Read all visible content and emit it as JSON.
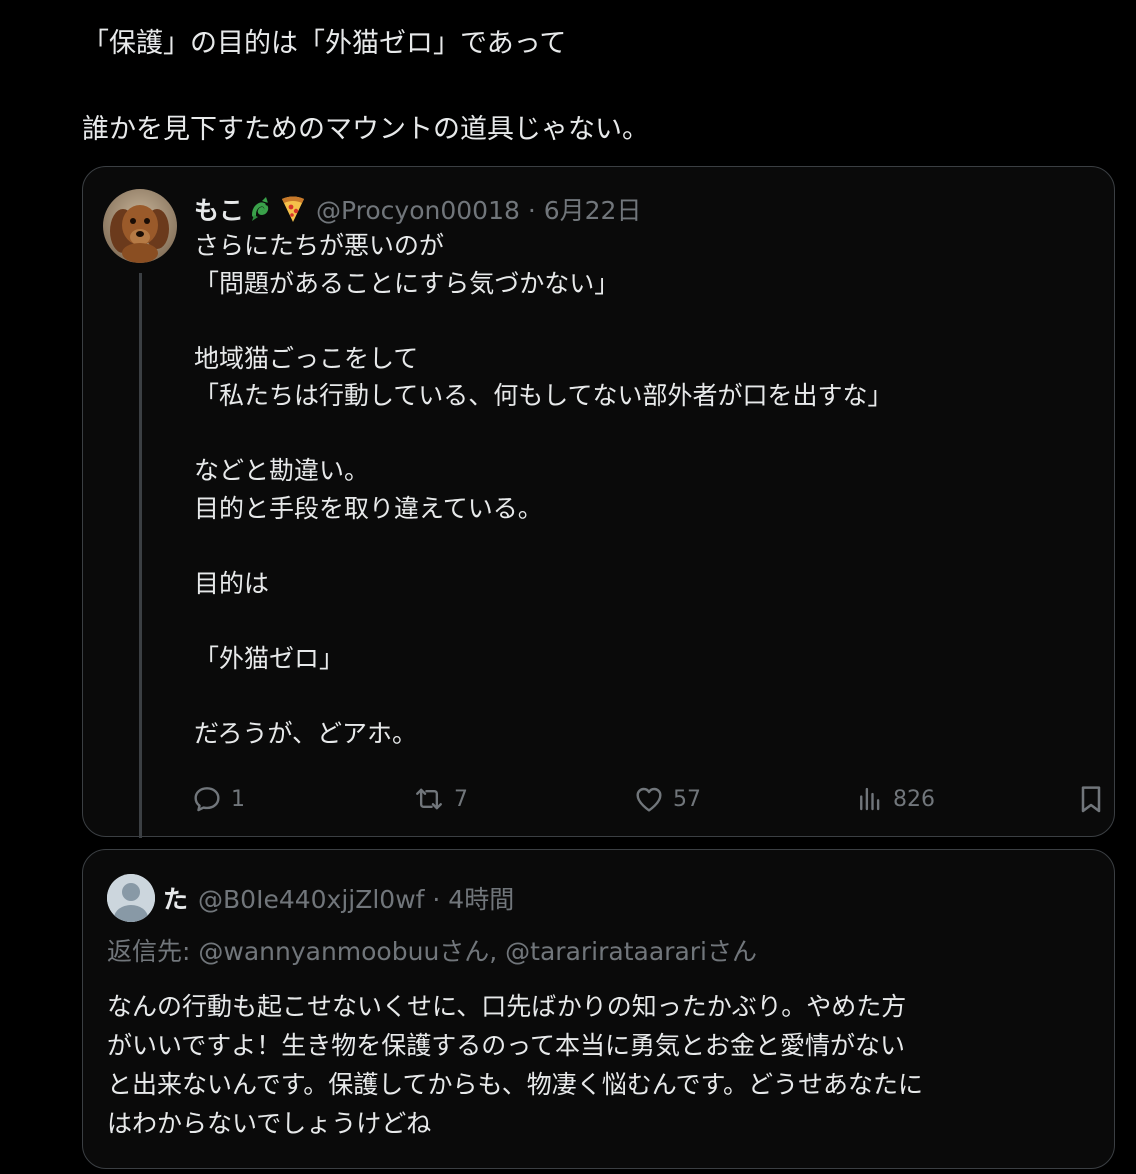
{
  "post": {
    "lines": [
      "「保護」の目的は「外猫ゼロ」であって",
      "",
      "誰かを見下すためのマウントの道具じゃない。"
    ]
  },
  "quoted": {
    "name": "もこ",
    "emoji_1": "🐉",
    "emoji_2": "🍕",
    "handle_time": "@Procyon00018 · 6月22日",
    "lines": [
      "さらにたちが悪いのが",
      "「問題があることにすら気づかない」",
      "",
      "地域猫ごっこをして",
      "「私たちは行動している、何もしてない部外者が口を出すな」",
      "",
      "などと勘違い。",
      "目的と手段を取り違えている。",
      "",
      "目的は",
      "",
      "「外猫ゼロ」",
      "",
      "だろうが、どアホ。"
    ],
    "actions": {
      "reply_count": "1",
      "repost_count": "7",
      "like_count": "57",
      "view_count": "826"
    },
    "icons": [
      "reply-icon",
      "repost-icon",
      "like-icon",
      "views-icon",
      "bookmark-icon"
    ]
  },
  "reply": {
    "name": "た",
    "handle_time": "@B0Ie440xjjZl0wf · 4時間",
    "replying_to": "返信先: @wannyanmoobuuさん, @tararirataarariさん",
    "lines": [
      "なんの行動も起こせないくせに、口先ばかりの知ったかぶり。やめた方",
      "がいいですよ！生き物を保護するのって本当に勇気とお金と愛情がない",
      "と出来ないんです。保護してからも、物凄く悩むんです。どうせあなたに",
      "はわからないでしょうけどね"
    ]
  },
  "colors": {
    "background": "#000000",
    "text": "#e7e9ea",
    "secondary": "#71767b",
    "border": "#3b3f43"
  }
}
